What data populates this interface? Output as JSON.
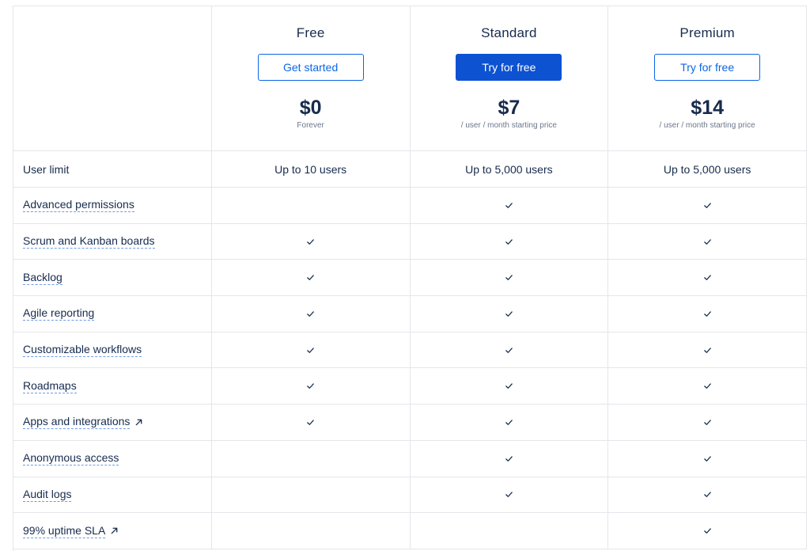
{
  "plans": [
    {
      "name": "Free",
      "button": "Get started",
      "price": "$0",
      "price_note": "Forever"
    },
    {
      "name": "Standard",
      "button": "Try for free",
      "price": "$7",
      "price_note": "/ user / month starting price"
    },
    {
      "name": "Premium",
      "button": "Try for free",
      "price": "$14",
      "price_note": "/ user / month starting price"
    }
  ],
  "user_limit": {
    "label": "User limit",
    "values": [
      "Up to 10 users",
      "Up to 5,000 users",
      "Up to 5,000 users"
    ]
  },
  "features": [
    {
      "label": "Advanced permissions",
      "external": false,
      "included": [
        false,
        true,
        true
      ]
    },
    {
      "label": "Scrum and Kanban boards",
      "external": false,
      "included": [
        true,
        true,
        true
      ]
    },
    {
      "label": "Backlog",
      "external": false,
      "included": [
        true,
        true,
        true
      ]
    },
    {
      "label": "Agile reporting",
      "external": false,
      "included": [
        true,
        true,
        true
      ]
    },
    {
      "label": "Customizable workflows",
      "external": false,
      "included": [
        true,
        true,
        true
      ]
    },
    {
      "label": "Roadmaps",
      "external": false,
      "included": [
        true,
        true,
        true
      ]
    },
    {
      "label": "Apps and integrations",
      "external": true,
      "included": [
        true,
        true,
        true
      ]
    },
    {
      "label": "Anonymous access",
      "external": false,
      "included": [
        false,
        true,
        true
      ]
    },
    {
      "label": "Audit logs",
      "external": false,
      "included": [
        false,
        true,
        true
      ]
    },
    {
      "label": "99% uptime SLA",
      "external": true,
      "included": [
        false,
        false,
        true
      ]
    }
  ],
  "icons": {
    "check": "check-icon",
    "external": "external-link-icon"
  },
  "colors": {
    "primary": "#0C52D1",
    "text": "#172B4D",
    "border": "#E4E6EA"
  }
}
